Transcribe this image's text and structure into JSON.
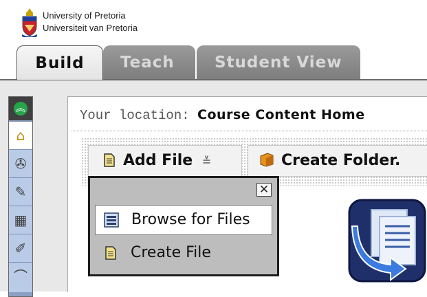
{
  "header": {
    "university_en": "University of Pretoria",
    "university_af": "Universiteit van Pretoria"
  },
  "tabs": [
    {
      "label": "Build",
      "active": true
    },
    {
      "label": "Teach",
      "active": false
    },
    {
      "label": "Student View",
      "active": false
    }
  ],
  "location": {
    "prefix": "Your location:",
    "value": "Course Content Home"
  },
  "toolbar": {
    "add_file": "Add File",
    "create_folder": "Create Folder."
  },
  "dropdown": {
    "close_glyph": "✕",
    "items": [
      {
        "label": "Browse for Files",
        "icon": "browse-icon"
      },
      {
        "label": "Create File",
        "icon": "document-icon"
      }
    ]
  },
  "rail": {
    "icons": [
      "collapse-icon",
      "home-icon",
      "announcement-icon",
      "tools-icon",
      "calendar-icon",
      "pin-icon"
    ]
  },
  "colors": {
    "rail_blue": "#b9cbe6",
    "tab_inactive": "#8a8a8a",
    "collapse_green": "#27a54a",
    "course_icon_navy": "#1f2f6a"
  }
}
